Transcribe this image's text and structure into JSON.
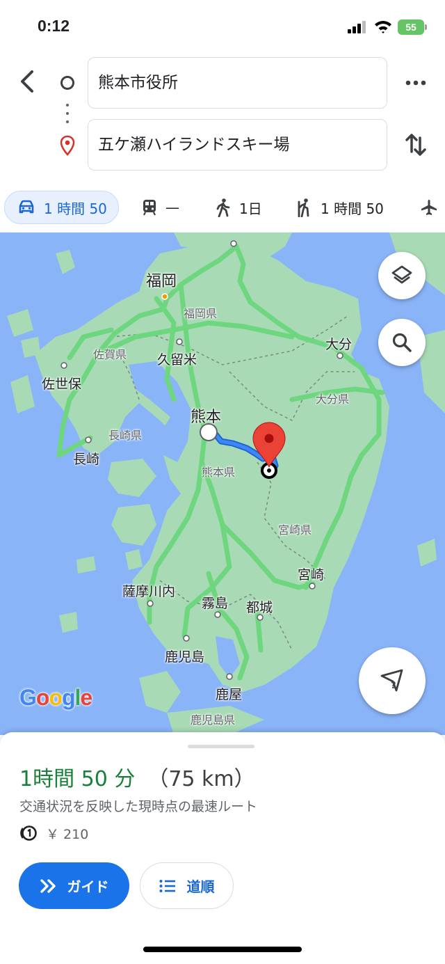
{
  "status_bar": {
    "time": "0:12",
    "battery": "55"
  },
  "route": {
    "origin": "熊本市役所",
    "destination": "五ケ瀬ハイランドスキー場"
  },
  "travel_modes": [
    {
      "mode": "car",
      "icon": "car-icon",
      "label": "1 時間 50",
      "active": true
    },
    {
      "mode": "transit",
      "icon": "train-icon",
      "label": "—"
    },
    {
      "mode": "walk",
      "icon": "walk-icon",
      "label": "1日"
    },
    {
      "mode": "ride",
      "icon": "ride-icon",
      "label": "1 時間 50"
    },
    {
      "mode": "flight",
      "icon": "airplane-icon",
      "label": ""
    }
  ],
  "map": {
    "cities": {
      "fukuoka": "福岡",
      "kurume": "久留米",
      "saga_pref": "佐賀県",
      "fukuoka_pref": "福岡県",
      "sasebo": "佐世保",
      "nagasaki_pref": "長崎県",
      "nagasaki": "長崎",
      "kumamoto": "熊本",
      "kumamoto_pref": "熊本県",
      "oita": "大分",
      "oita_pref": "大分県",
      "miyazaki_pref": "宮崎県",
      "miyazaki": "宮崎",
      "satsumasendai": "薩摩川内",
      "kirishima": "霧島",
      "miyakonojo": "都城",
      "kagoshima": "鹿児島",
      "kanoya": "鹿屋",
      "kagoshima_pref": "鹿児島県"
    },
    "logo": "Google",
    "colors": {
      "water": "#8ab4f8",
      "land": "#a8dab5",
      "highway": "#6fd680",
      "route": "#4285f4",
      "pin": "#ea4335"
    }
  },
  "summary": {
    "duration": "1時間 50 分",
    "distance": "（75 km）",
    "description": "交通状況を反映した現時点の最速ルート",
    "toll": "￥ 210"
  },
  "actions": {
    "guide_label": "ガイド",
    "steps_label": "道順"
  }
}
